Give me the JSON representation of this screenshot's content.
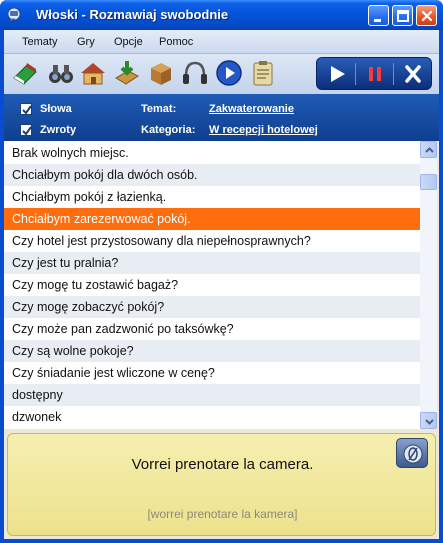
{
  "window": {
    "title": "Włoski - Rozmawiaj swobodnie"
  },
  "menu": {
    "items": [
      "Tematy",
      "Gry",
      "Opcje",
      "Pomoc"
    ]
  },
  "toolbar": {
    "tools": [
      "book-icon",
      "binoculars-icon",
      "house-icon",
      "download-icon",
      "box-icon",
      "headphones-icon",
      "play-circle-icon",
      "clipboard-icon"
    ],
    "transport": [
      "play-icon",
      "pause-icon",
      "stop-icon"
    ]
  },
  "info": {
    "checkbox1_label": "Słowa",
    "checkbox1_checked": true,
    "checkbox2_label": "Zwroty",
    "checkbox2_checked": true,
    "topic_label": "Temat:",
    "topic_value": "Zakwaterowanie",
    "category_label": "Kategoria:",
    "category_value": "W recepcji hotelowej"
  },
  "list": {
    "selected_index": 3,
    "items": [
      "Brak wolnych miejsc.",
      "Chciałbym pokój dla dwóch osób.",
      "Chciałbym pokój z łazienką.",
      "Chciałbym zarezerwować pokój.",
      "Czy hotel jest przystosowany dla niepełnosprawnych?",
      "Czy jest tu pralnia?",
      "Czy mogę tu zostawić bagaż?",
      "Czy mogę zobaczyć pokój?",
      "Czy może pan zadzwonić po taksówkę?",
      "Czy są wolne pokoje?",
      "Czy śniadanie jest wliczone w cenę?",
      "dostępny",
      "dzwonek"
    ]
  },
  "translation": {
    "text": "Vorrei prenotare la camera.",
    "phonetic": "[worrei prenotare la kamera]"
  },
  "colors": {
    "selection": "#ff6d0e",
    "header_blue": "#1e5bb5",
    "panel_yellow": "#f0e69a"
  }
}
